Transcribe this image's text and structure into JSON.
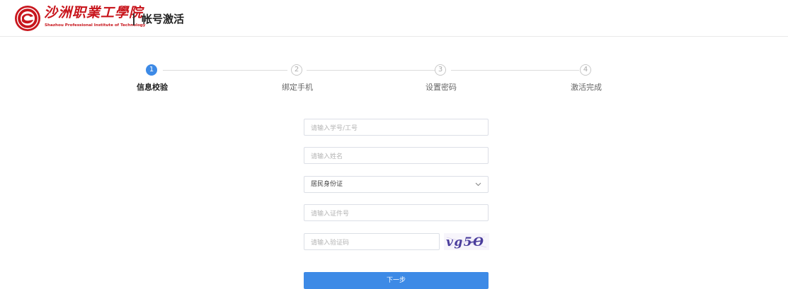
{
  "header": {
    "logo_script": "沙洲职業工學院",
    "logo_english": "Shazhou Professional Institute of Technology",
    "title": "帐号激活",
    "brand_color": "#c8161d"
  },
  "steps": [
    {
      "number": "1",
      "label": "信息校验",
      "state": "active"
    },
    {
      "number": "2",
      "label": "绑定手机",
      "state": "pending"
    },
    {
      "number": "3",
      "label": "设置密码",
      "state": "pending"
    },
    {
      "number": "4",
      "label": "激活完成",
      "state": "pending"
    }
  ],
  "form": {
    "id_placeholder": "请输入学号/工号",
    "name_placeholder": "请输入姓名",
    "doc_type_value": "居民身份证",
    "doc_number_placeholder": "请输入证件号",
    "captcha_placeholder": "请输入验证码",
    "captcha_text": "vg5O",
    "next_label": "下一步"
  },
  "colors": {
    "accent": "#3d8ae6",
    "step_pending": "#c8c8c8"
  }
}
